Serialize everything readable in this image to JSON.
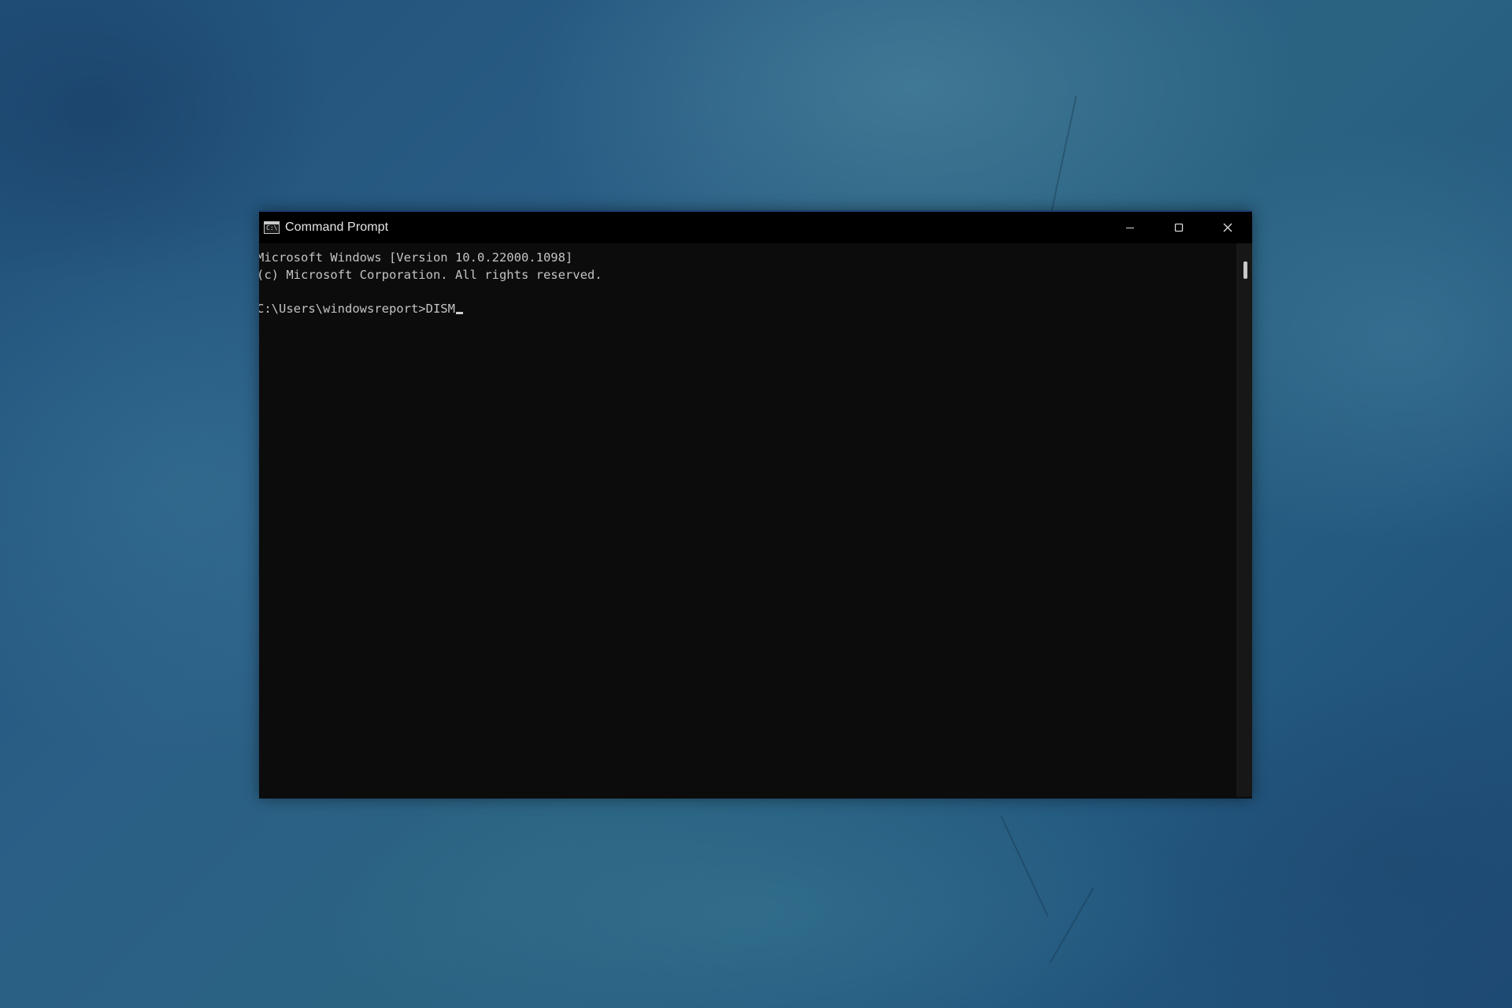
{
  "window": {
    "title": "Command Prompt",
    "icon": "cmd-icon",
    "icon_glyph": "C:\\",
    "controls": {
      "minimize": "minimize-icon",
      "maximize": "maximize-icon",
      "close": "close-icon"
    }
  },
  "console": {
    "lines": [
      "Microsoft Windows [Version 10.0.22000.1098]",
      "(c) Microsoft Corporation. All rights reserved.",
      "",
      "C:\\Users\\windowsreport>DISM"
    ]
  },
  "colors": {
    "console_bg": "#0c0c0c",
    "titlebar_bg": "#000000",
    "console_text": "#c4c4c4",
    "desktop_base": "#2a5f86"
  }
}
